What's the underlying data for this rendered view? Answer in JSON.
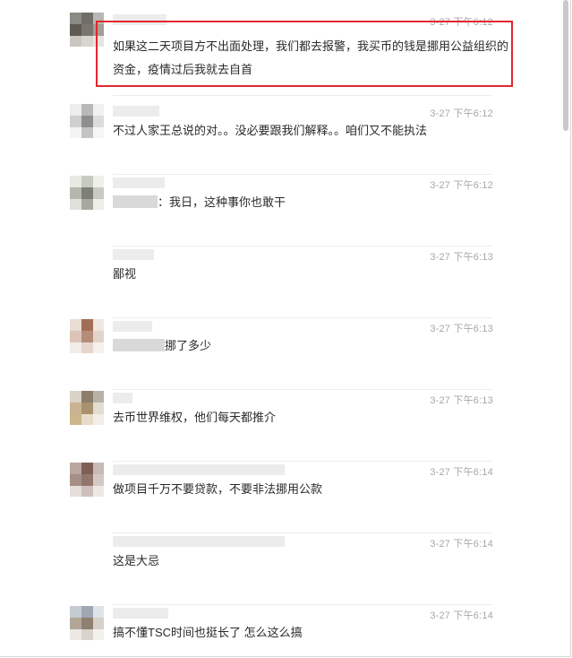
{
  "comments": [
    {
      "time": "3-27 下午6:12",
      "text": "如果这二天项目方不出面处理，我们都去报警，我买币的钱是挪用公益组织的资金，疫情过后我就去自首",
      "text_prefix_blurred": false,
      "highlighted": true
    },
    {
      "time": "3-27 下午6:12",
      "text": "不过人家王总说的对。。没必要跟我们解释。。咱们又不能执法",
      "text_prefix_blurred": false,
      "highlighted": false
    },
    {
      "time": "3-27 下午6:12",
      "text": "：我日，这种事你也敢干",
      "text_prefix_blurred": true,
      "highlighted": false
    },
    {
      "time": "3-27 下午6:13",
      "text": "鄙视",
      "text_prefix_blurred": false,
      "highlighted": false
    },
    {
      "time": "3-27 下午6:13",
      "text": "挪了多少",
      "text_prefix_blurred": true,
      "highlighted": false
    },
    {
      "time": "3-27 下午6:13",
      "text": "去币世界维权，他们每天都推介",
      "text_prefix_blurred": false,
      "highlighted": false
    },
    {
      "time": "3-27 下午6:14",
      "text": "做项目千万不要贷款，不要非法挪用公款",
      "text_prefix_blurred": false,
      "highlighted": false
    },
    {
      "time": "3-27 下午6:14",
      "text": "这是大忌",
      "text_prefix_blurred": false,
      "highlighted": false
    },
    {
      "time": "3-27 下午6:14",
      "text": "搞不懂TSC时间也挺长了 怎么这么搞",
      "text_prefix_blurred": false,
      "highlighted": false
    }
  ],
  "colors": {
    "highlight_border": "#e3262d",
    "timestamp": "#a8a8a8",
    "message_text": "#2a2a2a",
    "divider": "#ececec"
  }
}
